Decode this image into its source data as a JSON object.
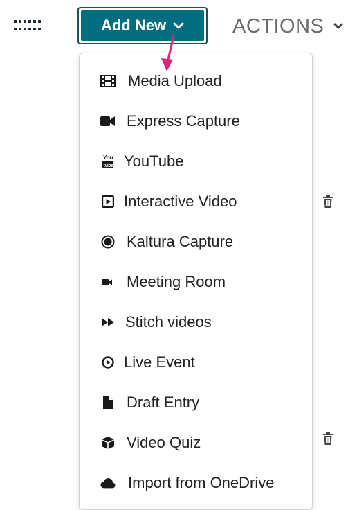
{
  "toolbar": {
    "add_new_label": "Add New",
    "actions_label": "ACTIONS"
  },
  "colors": {
    "add_button_bg": "#006e7f",
    "add_button_border": "#1d4f5c",
    "arrow": "#e0267a",
    "menu_text": "#222222",
    "actions_text": "#6b6b6b"
  },
  "menu": {
    "items": [
      {
        "label": "Media Upload",
        "icon": "film-icon"
      },
      {
        "label": "Express Capture",
        "icon": "video-camera-icon"
      },
      {
        "label": "YouTube",
        "icon": "youtube-icon"
      },
      {
        "label": "Interactive Video",
        "icon": "play-square-icon"
      },
      {
        "label": "Kaltura Capture",
        "icon": "record-icon"
      },
      {
        "label": "Meeting Room",
        "icon": "small-camera-icon"
      },
      {
        "label": "Stitch videos",
        "icon": "fast-forward-icon"
      },
      {
        "label": "Live Event",
        "icon": "play-circle-icon"
      },
      {
        "label": "Draft Entry",
        "icon": "file-icon"
      },
      {
        "label": "Video Quiz",
        "icon": "cube-icon"
      },
      {
        "label": "Import from OneDrive",
        "icon": "cloud-icon"
      }
    ]
  }
}
